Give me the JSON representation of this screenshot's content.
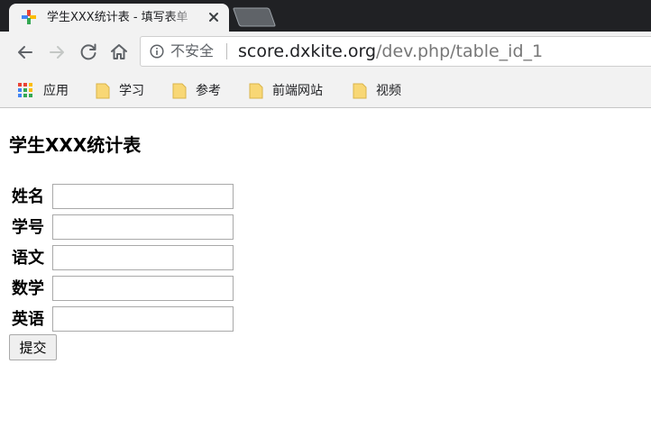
{
  "tab": {
    "title": "学生XXX统计表 - 填写表单"
  },
  "toolbar": {
    "security_label": "不安全",
    "url_host": "score.dxkite.org",
    "url_path": "/dev.php/table_id_1"
  },
  "bookmarks": [
    {
      "label": "应用",
      "icon": "apps-grid-icon"
    },
    {
      "label": "学习",
      "icon": "folder-icon"
    },
    {
      "label": "参考",
      "icon": "folder-icon"
    },
    {
      "label": "前端网站",
      "icon": "folder-icon"
    },
    {
      "label": "视频",
      "icon": "folder-icon"
    }
  ],
  "page": {
    "heading": "学生XXX统计表",
    "fields": [
      {
        "label": "姓名",
        "value": ""
      },
      {
        "label": "学号",
        "value": ""
      },
      {
        "label": "语文",
        "value": ""
      },
      {
        "label": "数学",
        "value": ""
      },
      {
        "label": "英语",
        "value": ""
      }
    ],
    "submit_label": "提交"
  },
  "colors": {
    "tabstrip_bg": "#202124",
    "toolbar_bg": "#f2f2f2",
    "folder_yellow": "#f8d775"
  }
}
